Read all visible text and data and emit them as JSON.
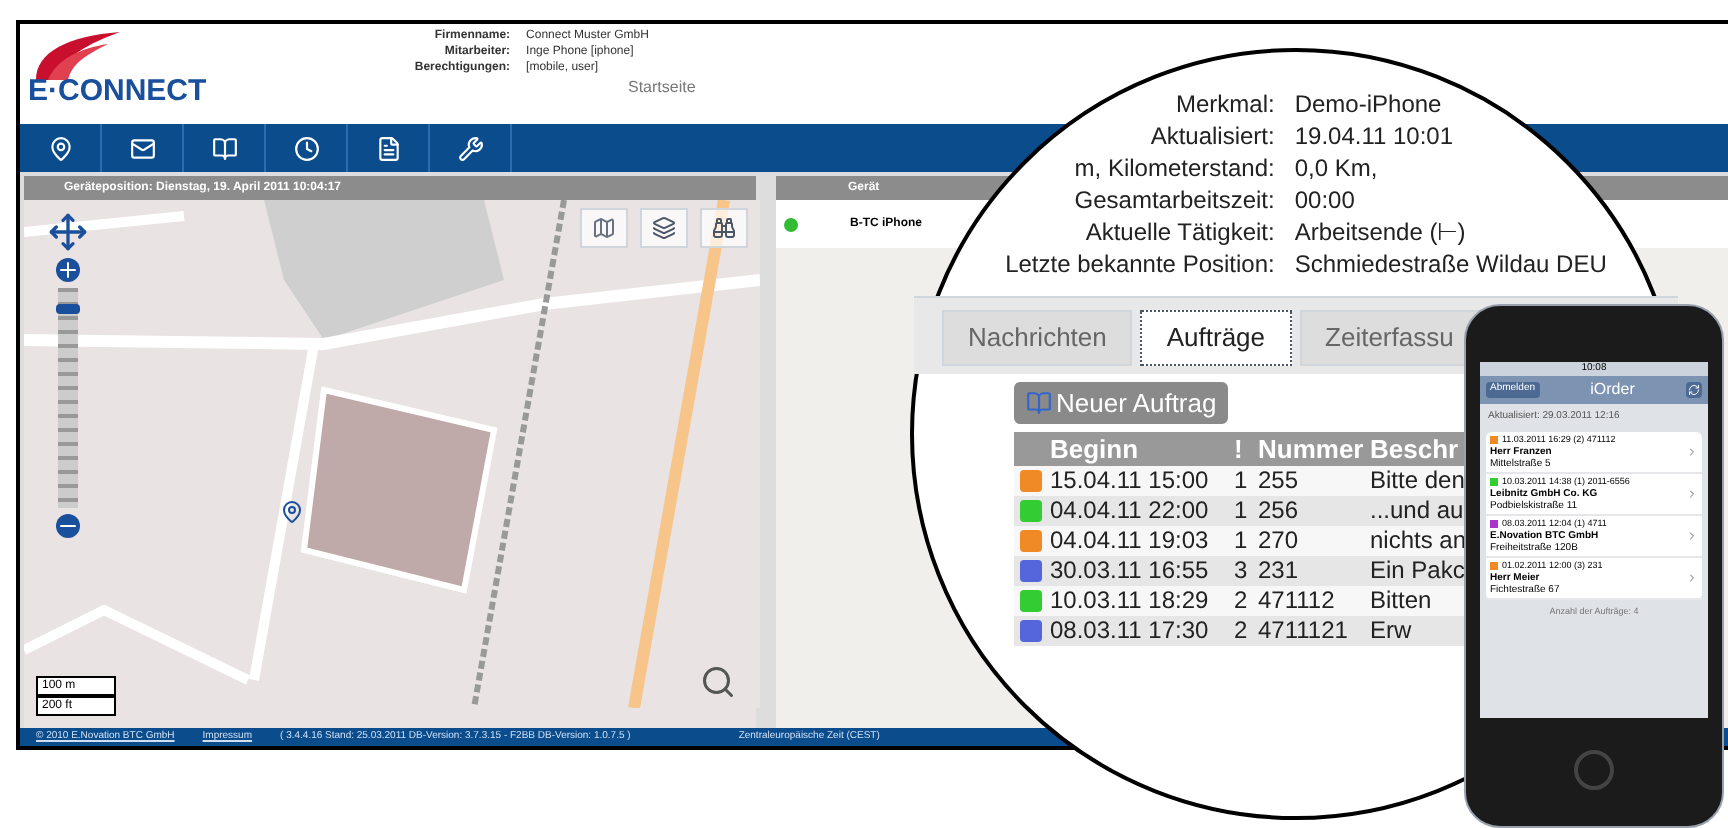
{
  "header": {
    "logo": "E·CONNECT",
    "info": [
      {
        "label": "Firmenname:",
        "value": "Connect Muster GmbH"
      },
      {
        "label": "Mitarbeiter:",
        "value": "Inge Phone [iphone]"
      },
      {
        "label": "Berechtigungen:",
        "value": "[mobile, user]"
      }
    ],
    "page_title": "Startseite"
  },
  "map_panel": {
    "title": "Geräteposition: Dienstag, 19. April 2011 10:04:17",
    "zoom": {
      "level": 0.92
    },
    "scale": [
      "100 m",
      "200 ft"
    ]
  },
  "device_panel": {
    "column": "Gerät",
    "devices": [
      {
        "name": "B-TC iPhone",
        "color": "#33bb33"
      }
    ]
  },
  "footer": {
    "copyright": "© 2010 E.Novation BTC GmbH",
    "imprint": "Impressum",
    "version": "( 3.4.4.16  Stand: 25.03.2011  DB-Version: 3.7.3.15 - F2BB DB-Version: 1.0.7.5 )",
    "timezone": "Zentraleuropäische Zeit (CEST)"
  },
  "magnifier": {
    "details": [
      {
        "label": "Merkmal:",
        "value": "Demo-iPhone"
      },
      {
        "label": "Aktualisiert:",
        "value": "19.04.11 10:01"
      },
      {
        "label": "m, Kilometerstand:",
        "value": "0,0 Km,"
      },
      {
        "label": "Gesamtarbeitszeit:",
        "value": "00:00"
      },
      {
        "label": "Aktuelle Tätigkeit:",
        "value": "Arbeitsende (⊢)"
      },
      {
        "label": "Letzte bekannte Position:",
        "value": "Schmiedestraße Wildau DEU"
      }
    ],
    "tabs": [
      {
        "label": "Nachrichten",
        "selected": false
      },
      {
        "label": "Aufträge",
        "selected": true
      },
      {
        "label": "Zeiterfassu",
        "selected": false
      }
    ],
    "new_order_button": "Neuer Auftrag",
    "columns": [
      "Beginn",
      "!",
      "Nummer",
      "Beschr"
    ],
    "rows": [
      {
        "color": "#f08a24",
        "begin": "15.04.11 15:00",
        "priority": "1",
        "number": "255",
        "description": "Bitte den"
      },
      {
        "color": "#33cc33",
        "begin": "04.04.11 22:00",
        "priority": "1",
        "number": "256",
        "description": "...und au"
      },
      {
        "color": "#f08a24",
        "begin": "04.04.11 19:03",
        "priority": "1",
        "number": "270",
        "description": "nichts an"
      },
      {
        "color": "#5566dd",
        "begin": "30.03.11 16:55",
        "priority": "3",
        "number": "231",
        "description": "Ein Pakc"
      },
      {
        "color": "#33cc33",
        "begin": "10.03.11 18:29",
        "priority": "2",
        "number": "471112",
        "description": "Bitten"
      },
      {
        "color": "#5566dd",
        "begin": "08.03.11 17:30",
        "priority": "2",
        "number": "4711121",
        "description": "Erw"
      }
    ]
  },
  "phone": {
    "time": "10:08",
    "back_button": "Abmelden",
    "title": "iOrder",
    "updated": "Aktualisiert: 29.03.2011 12:16",
    "orders": [
      {
        "color": "#f08a24",
        "meta": "11.03.2011 16:29 (2) 471112",
        "name": "Herr Franzen",
        "address": "Mittelstraße 5"
      },
      {
        "color": "#33cc33",
        "meta": "10.03.2011 14:38 (1) 2011-6556",
        "name": "Leibnitz GmbH Co. KG",
        "address": "Podbielskistraße 11"
      },
      {
        "color": "#aa33cc",
        "meta": "08.03.2011 12:04 (1) 4711",
        "name": "E.Novation BTC GmbH",
        "address": "Freiheitstraße 120B"
      },
      {
        "color": "#f08a24",
        "meta": "01.02.2011 12:00 (3) 231",
        "name": "Herr Meier",
        "address": "Fichtestraße 67"
      }
    ],
    "count": "Anzahl der Aufträge: 4"
  }
}
